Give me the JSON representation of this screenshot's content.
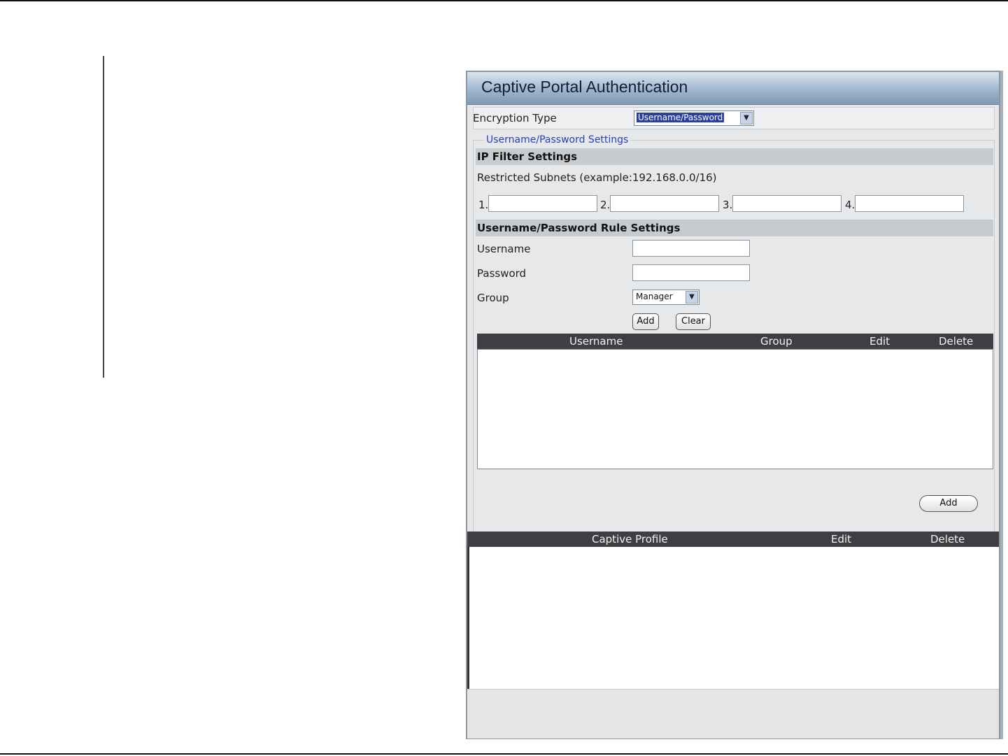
{
  "title": "Captive Portal Authentication",
  "encryption": {
    "label": "Encryption Type",
    "selected": "Username/Password"
  },
  "settings_legend": "Username/Password Settings",
  "ip_filter": {
    "heading": "IP Filter Settings",
    "restricted_label": "Restricted Subnets (example:192.168.0.0/16)",
    "subnet_labels": [
      "1.",
      "2.",
      "3.",
      "4."
    ]
  },
  "rule": {
    "heading": "Username/Password Rule Settings",
    "username_label": "Username",
    "password_label": "Password",
    "group_label": "Group",
    "group_selected": "Manager",
    "add_label": "Add",
    "clear_label": "Clear"
  },
  "user_table": {
    "columns": [
      "Username",
      "Group",
      "Edit",
      "Delete"
    ]
  },
  "add_profile_label": "Add",
  "profile_table": {
    "columns": [
      "Captive Profile",
      "Edit",
      "Delete"
    ]
  }
}
